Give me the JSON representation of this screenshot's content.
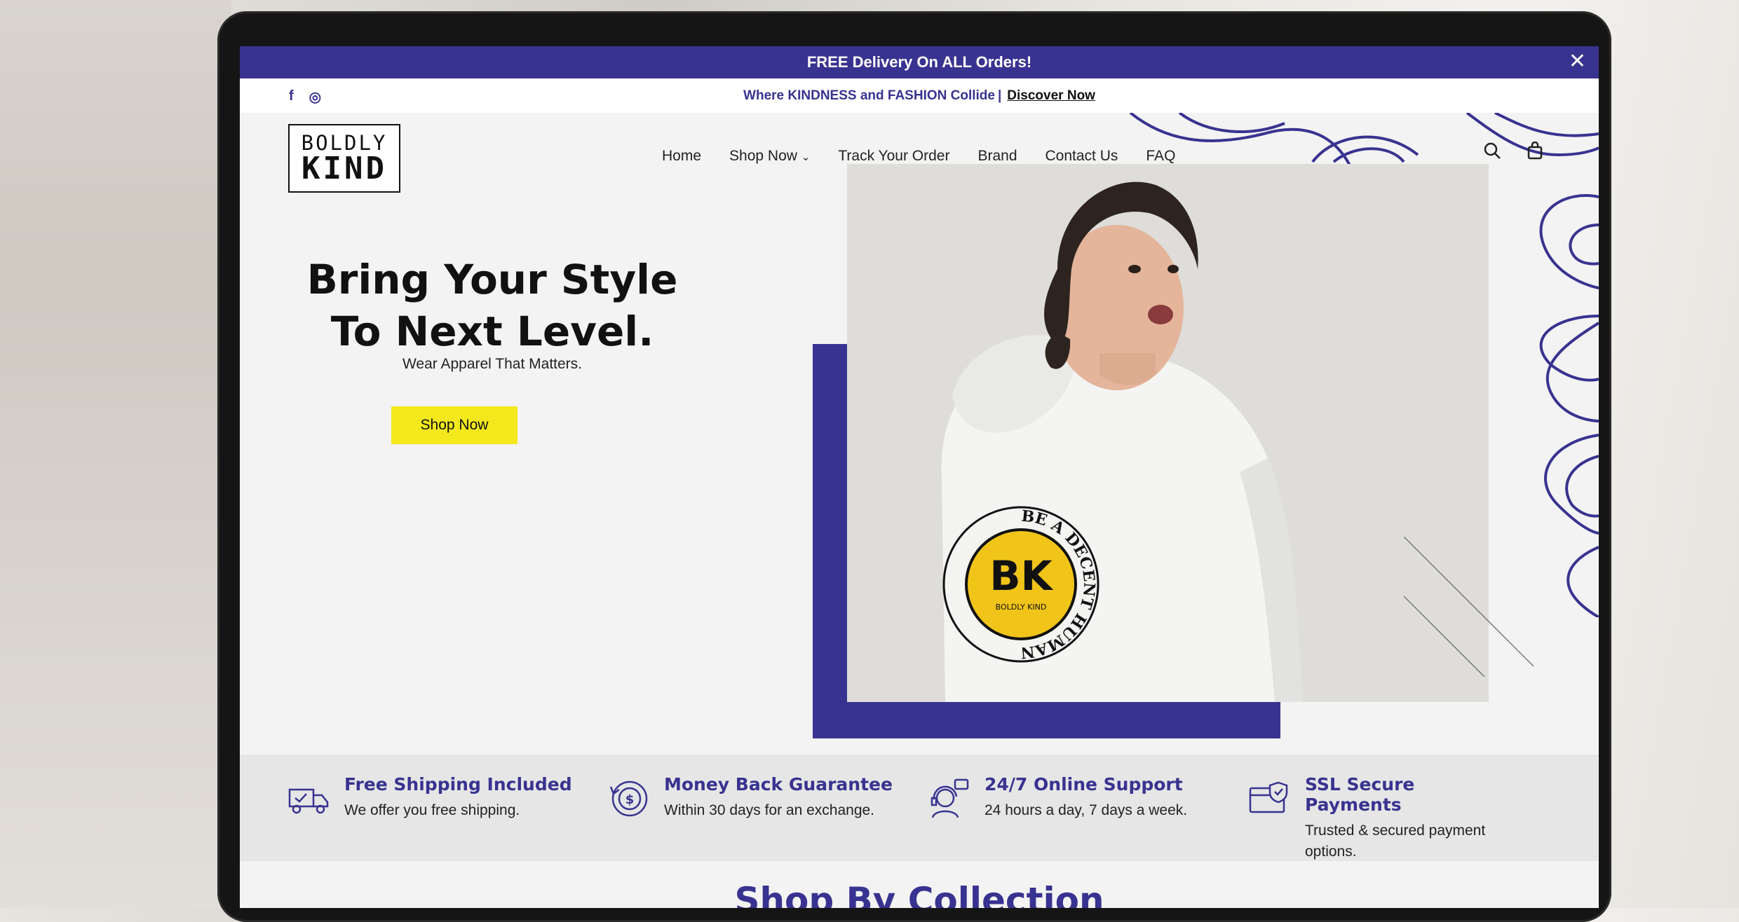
{
  "announcement": {
    "text": "FREE Delivery On ALL Orders!",
    "close": "✕"
  },
  "subbar": {
    "tagline": "Where KINDNESS and FASHION Collide",
    "separator": "|",
    "link": "Discover Now"
  },
  "social": {
    "facebook": "f",
    "instagram": "◎"
  },
  "logo": {
    "line1": "BOLDLY",
    "line2": "KIND"
  },
  "nav": {
    "home": "Home",
    "shop": "Shop Now",
    "shop_arrow": "⌄",
    "track": "Track Your Order",
    "brand": "Brand",
    "contact": "Contact Us",
    "faq": "FAQ"
  },
  "hero": {
    "title_line1": "Bring Your Style",
    "title_line2": "To Next Level.",
    "subtitle": "Wear Apparel That Matters.",
    "button": "Shop Now"
  },
  "hoodie_print": {
    "monogram": "BK",
    "brand": "BOLDLY KIND",
    "ring_text": "BE A DECENT HUMAN"
  },
  "features": [
    {
      "title": "Free Shipping Included",
      "desc": "We offer you free shipping.",
      "icon": "truck-icon"
    },
    {
      "title": "Money Back Guarantee",
      "desc": "Within 30 days for an exchange.",
      "icon": "money-back-icon"
    },
    {
      "title": "24/7 Online Support",
      "desc": "24 hours a day, 7 days a week.",
      "icon": "support-agent-icon"
    },
    {
      "title": "SSL Secure Payments",
      "desc": "Trusted & secured payment options.",
      "icon": "secure-card-icon"
    }
  ],
  "section_title": "Shop By Collection",
  "colors": {
    "brand_purple": "#383390",
    "accent_yellow": "#f2e81c"
  }
}
